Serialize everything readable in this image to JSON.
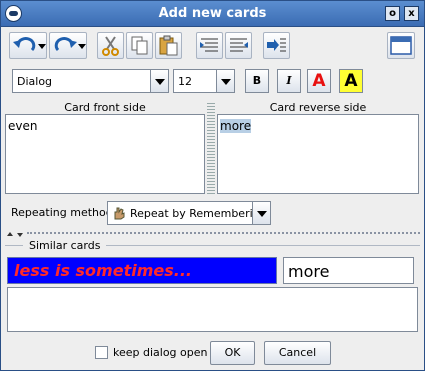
{
  "window": {
    "title": "Add new cards",
    "min_symbol": "o",
    "close_symbol": "x"
  },
  "toolbar": {
    "icons": [
      "undo-icon",
      "redo-icon",
      "cut-icon",
      "copy-icon",
      "paste-icon",
      "align-left-icon",
      "align-right-icon",
      "insert-icon",
      "window-icon"
    ]
  },
  "format": {
    "font": "Dialog",
    "size": "12",
    "bold": "B",
    "italic": "I",
    "color_a": "A",
    "highlight_a": "A",
    "color_red": "#e81010",
    "highlight_yellow": "#ffff33"
  },
  "card": {
    "front_label": "Card front side",
    "back_label": "Card reverse side",
    "front_text": "even",
    "back_text": "more"
  },
  "repeating": {
    "label": "Repeating method:",
    "value": "Repeat by Remembering"
  },
  "similar": {
    "label": "Similar cards",
    "front": "less is sometimes...",
    "back": "more",
    "front_bg": "#0000ff",
    "front_color": "#ff2a2a"
  },
  "footer": {
    "keep_open_label": "keep dialog open",
    "ok_label": "OK",
    "cancel_label": "Cancel"
  }
}
